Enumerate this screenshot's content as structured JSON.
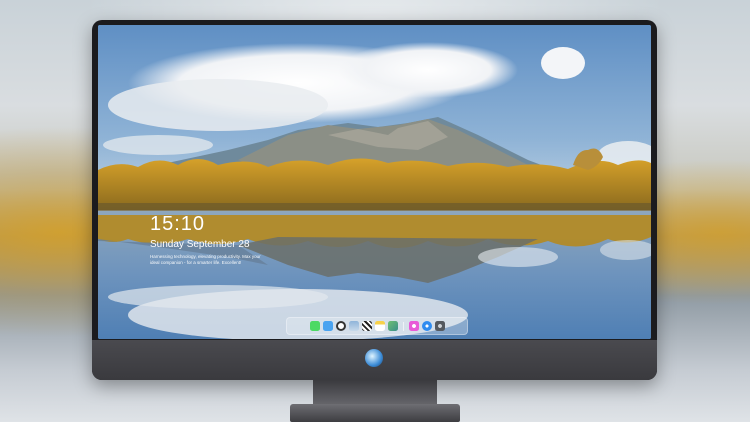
{
  "lock_screen": {
    "time": "15:10",
    "date": "Sunday September 28",
    "note": "Harnessing technology, elevating productivity. Max your ideal companion - for a smarter life. Excellent!"
  },
  "dock": {
    "icons": [
      {
        "name": "messages-icon",
        "color": "#4cd964"
      },
      {
        "name": "finder-icon",
        "color": "#4aa3f0"
      },
      {
        "name": "clock-icon",
        "color": "#e5e5e5"
      },
      {
        "name": "preview-icon",
        "color": "#8fb4d9"
      },
      {
        "name": "clapperboard-icon",
        "color": "#2c2c2c"
      },
      {
        "name": "notes-icon",
        "color": "#f7d14a"
      },
      {
        "name": "photos-icon",
        "color": "#6fbf73"
      },
      {
        "name": "itunes-icon",
        "color": "#e85ad8"
      },
      {
        "name": "app-store-icon",
        "color": "#2f8cf0"
      },
      {
        "name": "camera-icon",
        "color": "#555a60"
      }
    ]
  }
}
